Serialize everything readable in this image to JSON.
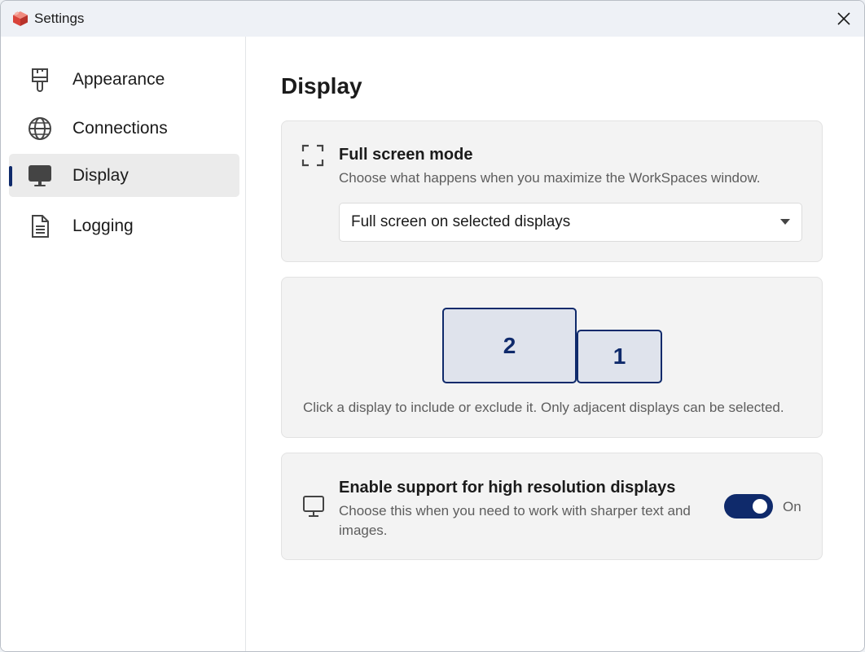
{
  "window": {
    "title": "Settings"
  },
  "sidebar": {
    "items": [
      {
        "label": "Appearance",
        "icon": "paintbrush-icon"
      },
      {
        "label": "Connections",
        "icon": "globe-icon"
      },
      {
        "label": "Display",
        "icon": "monitor-icon",
        "active": true
      },
      {
        "label": "Logging",
        "icon": "document-icon"
      }
    ]
  },
  "main": {
    "title": "Display",
    "fullscreen": {
      "title": "Full screen mode",
      "description": "Choose what happens when you maximize the WorkSpaces window.",
      "selected_option": "Full screen on selected displays"
    },
    "displays": {
      "monitors": [
        "2",
        "1"
      ],
      "hint": "Click a display to include or exclude it. Only adjacent displays can be selected."
    },
    "high_res": {
      "title": "Enable support for high resolution displays",
      "description": "Choose this when you need to work with sharper text and images.",
      "toggle_state": "On"
    }
  },
  "colors": {
    "accent": "#0f2a6b",
    "monitor_fill": "#dfe3ec",
    "card_bg": "#f3f3f3"
  }
}
